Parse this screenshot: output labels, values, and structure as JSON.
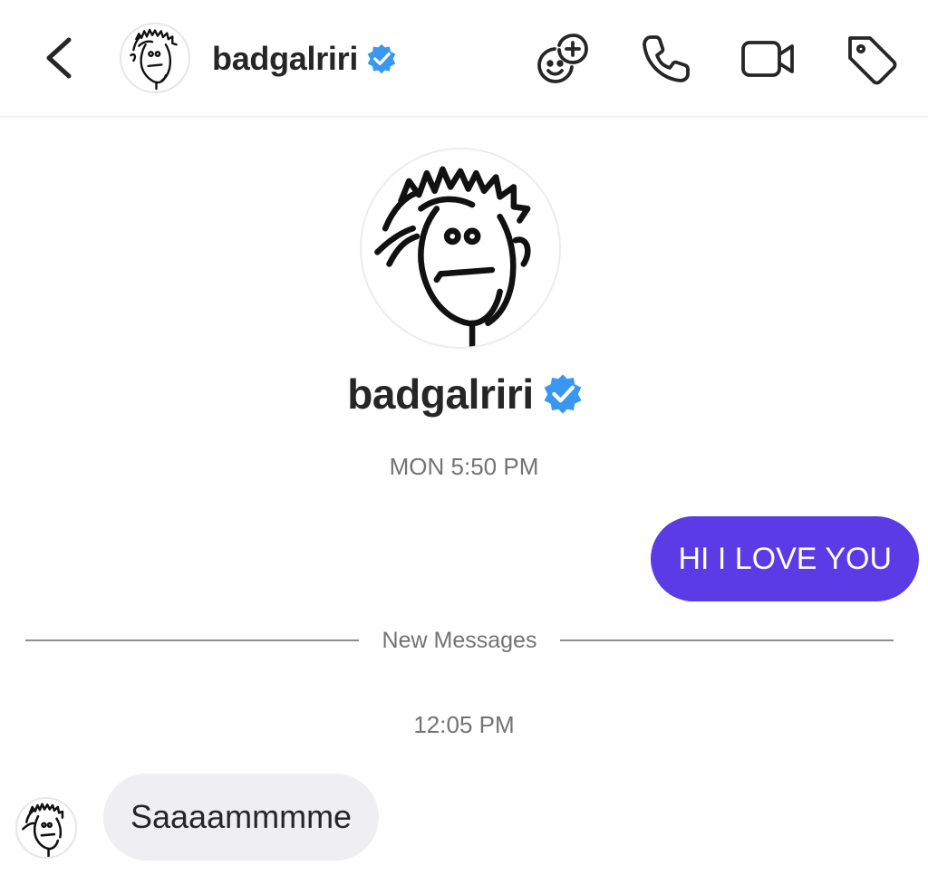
{
  "header": {
    "username": "badgalriri",
    "verified": true,
    "icons": [
      "back-chevron-icon",
      "avatar",
      "verified-badge-icon",
      "stickers-add-icon",
      "phone-icon",
      "video-camera-icon",
      "tag-icon"
    ]
  },
  "profile": {
    "username": "badgalriri",
    "verified": true
  },
  "conversation": {
    "first_timestamp": "MON 5:50 PM",
    "sent_message": "HI I LOVE YOU",
    "divider_label": "New Messages",
    "second_timestamp": "12:05 PM",
    "received_message": "Saaaammmme"
  },
  "colors": {
    "sent_bubble": "#5b3be6",
    "received_bubble": "#efeff1",
    "verified_badge": "#3897f0",
    "text_primary": "#262626",
    "text_secondary": "#737373"
  }
}
